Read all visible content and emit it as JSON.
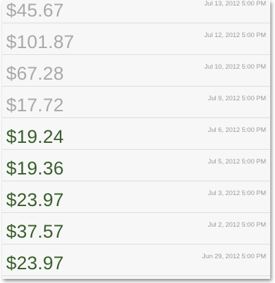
{
  "colors": {
    "muted": "#a9a9a9",
    "accent": "#3b5f2e",
    "date": "#9a9a9a"
  },
  "transactions": [
    {
      "amount": "$45.67",
      "date": "Jul 13, 2012 5:00 PM",
      "style": "grey"
    },
    {
      "amount": "$101.87",
      "date": "Jul 12, 2012 5:00 PM",
      "style": "grey"
    },
    {
      "amount": "$67.28",
      "date": "Jul 10, 2012 5:00 PM",
      "style": "grey"
    },
    {
      "amount": "$17.72",
      "date": "Jul 9, 2012 5:00 PM",
      "style": "grey"
    },
    {
      "amount": "$19.24",
      "date": "Jul 6, 2012 5:00 PM",
      "style": "green"
    },
    {
      "amount": "$19.36",
      "date": "Jul 5, 2012 5:00 PM",
      "style": "green"
    },
    {
      "amount": "$23.97",
      "date": "Jul 3, 2012 5:00 PM",
      "style": "green"
    },
    {
      "amount": "$37.57",
      "date": "Jul 2, 2012 5:00 PM",
      "style": "green"
    },
    {
      "amount": "$23.97",
      "date": "Jun 29, 2012 5:00 PM",
      "style": "green"
    }
  ]
}
